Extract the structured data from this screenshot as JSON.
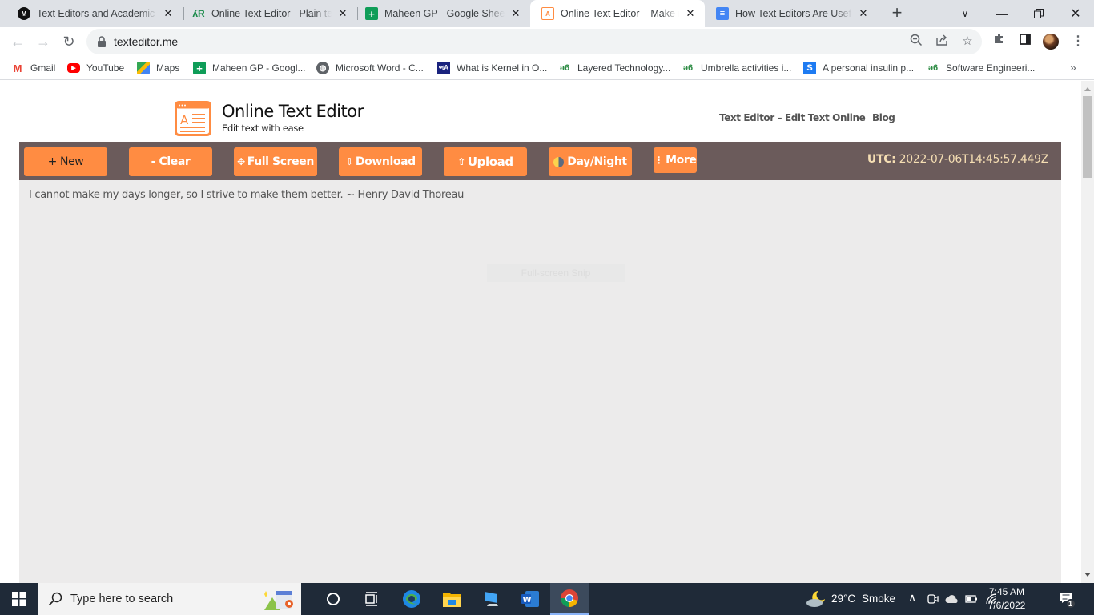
{
  "browser": {
    "tabs": [
      {
        "title": "Text Editors and Academic W",
        "icon": "medium-icon",
        "active": false
      },
      {
        "title": "Online Text Editor - Plain text",
        "icon": "pr-icon",
        "active": false
      },
      {
        "title": "Maheen GP - Google Sheets",
        "icon": "sheets-icon",
        "active": false
      },
      {
        "title": "Online Text Editor – Make no",
        "icon": "texteditor-icon",
        "active": true
      },
      {
        "title": "How Text Editors Are Useful i",
        "icon": "docs-icon",
        "active": false
      }
    ],
    "close_glyph": "✕",
    "new_tab_glyph": "+",
    "url": "texteditor.me",
    "bookmarks": [
      {
        "label": "Gmail",
        "icon": "gmail-icon"
      },
      {
        "label": "YouTube",
        "icon": "youtube-icon"
      },
      {
        "label": "Maps",
        "icon": "maps-icon"
      },
      {
        "label": "Maheen GP - Googl...",
        "icon": "sheets-icon"
      },
      {
        "label": "Microsoft Word - C...",
        "icon": "globe-icon"
      },
      {
        "label": "What is Kernel in O...",
        "icon": "javatpoint-icon"
      },
      {
        "label": "Layered Technology...",
        "icon": "geeksforgeeks-icon"
      },
      {
        "label": "Umbrella activities i...",
        "icon": "geeksforgeeks-icon"
      },
      {
        "label": "A personal insulin p...",
        "icon": "scribd-icon"
      },
      {
        "label": "Software Engineeri...",
        "icon": "geeksforgeeks-icon"
      }
    ],
    "bookmarks_overflow": "»"
  },
  "site": {
    "title": "Online Text Editor",
    "subtitle": "Edit text with ease",
    "nav": [
      "Text Editor – Edit Text Online",
      "Blog"
    ],
    "accent_color": "#ff8c42",
    "bar_color": "#6b5b5b",
    "buttons": [
      {
        "label": "+ New",
        "glyph": ""
      },
      {
        "label": "- Clear",
        "glyph": ""
      },
      {
        "label": "Full Screen",
        "glyph": "✥"
      },
      {
        "label": "Download",
        "glyph": "⇩"
      },
      {
        "label": "Upload",
        "glyph": "⇧"
      },
      {
        "label": "Day/Night",
        "glyph": ""
      },
      {
        "label": "More",
        "glyph": "⋮"
      }
    ],
    "utc_label": "UTC:",
    "utc_value": " 2022-07-06T14:45:57.449Z",
    "editor_text": "I cannot make my days longer, so I strive to make them better. ~ Henry David Thoreau",
    "overlay_text": "Full-screen Snip"
  },
  "taskbar": {
    "search_placeholder": "Type here to search",
    "weather_temp": "29°C",
    "weather_desc": "Smoke",
    "time": "7:45 AM",
    "date": "7/6/2022",
    "notification_count": "1"
  }
}
